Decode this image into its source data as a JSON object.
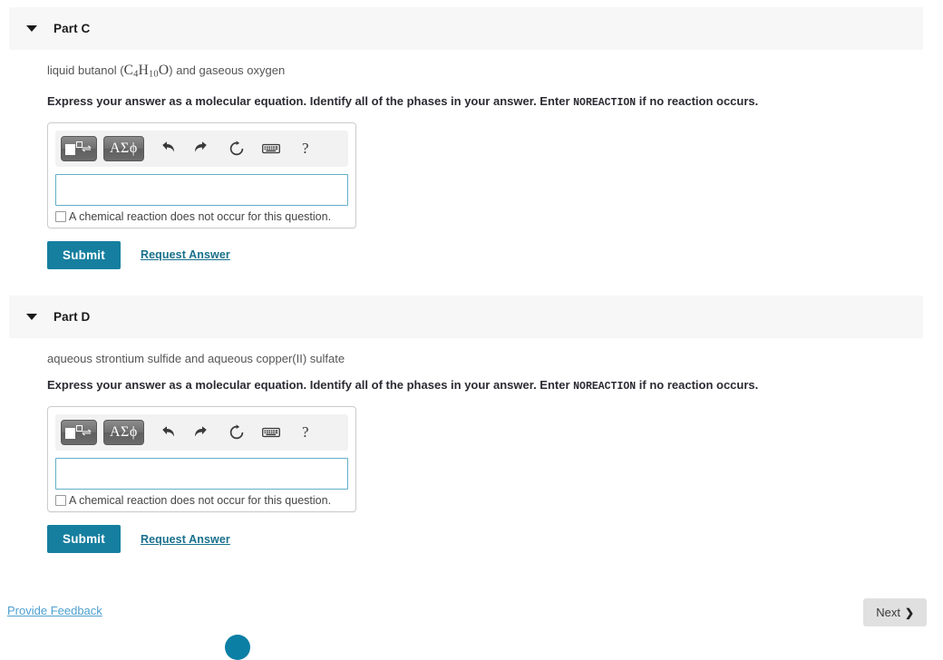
{
  "parts": [
    {
      "id": "part-c",
      "title": "Part C",
      "caret_icon": "caret-down-icon",
      "reactants_prefix": "liquid butanol (",
      "formula": [
        {
          "text": "C",
          "sub": "4"
        },
        {
          "text": "H",
          "sub": "10"
        },
        {
          "text": "O",
          "sub": ""
        }
      ],
      "reactants_suffix": ") and gaseous oxygen",
      "instruction_before": "Express your answer as a molecular equation. Identify all of the phases in your answer. Enter ",
      "instruction_mono": "NOREACTION",
      "instruction_after": " if no reaction occurs.",
      "toolbar": {
        "template_button_label": "template-button",
        "greek_button_label": "ΑΣϕ",
        "undo_label": "undo-icon",
        "redo_label": "redo-icon",
        "reset_label": "reset-icon",
        "keyboard_label": "keyboard-icon",
        "help_label": "?"
      },
      "input_value": "",
      "input_placeholder": "",
      "no_reaction_label": "A chemical reaction does not occur for this question.",
      "no_reaction_checked": false,
      "submit_label": "Submit",
      "request_answer_label": "Request Answer"
    },
    {
      "id": "part-d",
      "title": "Part D",
      "caret_icon": "caret-down-icon",
      "reactants_prefix": "aqueous strontium sulfide and aqueous copper(II) sulfate",
      "formula": [],
      "reactants_suffix": "",
      "instruction_before": "Express your answer as a molecular equation. Identify all of the phases in your answer. Enter ",
      "instruction_mono": "NOREACTION",
      "instruction_after": " if no reaction occurs.",
      "toolbar": {
        "template_button_label": "template-button",
        "greek_button_label": "ΑΣϕ",
        "undo_label": "undo-icon",
        "redo_label": "redo-icon",
        "reset_label": "reset-icon",
        "keyboard_label": "keyboard-icon",
        "help_label": "?"
      },
      "input_value": "",
      "input_placeholder": "",
      "no_reaction_label": "A chemical reaction does not occur for this question.",
      "no_reaction_checked": false,
      "submit_label": "Submit",
      "request_answer_label": "Request Answer"
    }
  ],
  "footer": {
    "provide_feedback_label": "Provide Feedback",
    "next_label": "Next",
    "next_chevron": "❯"
  },
  "colors": {
    "submit_teal": "#167f9f",
    "link_teal": "#18708c",
    "feedback_blue": "#4ea0cf",
    "header_gray": "#f7f7f7",
    "input_border": "#62afc9",
    "next_gray": "#e0e0e0",
    "floating_circle": "#0c7fa5"
  }
}
